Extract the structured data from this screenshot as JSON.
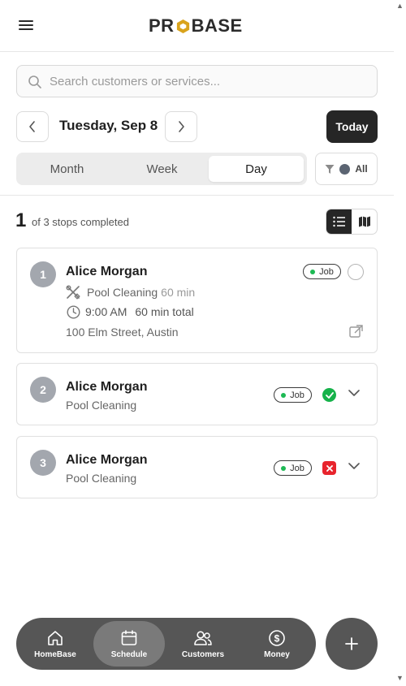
{
  "header": {
    "logo_text_left": "PR",
    "logo_text_right": "BASE"
  },
  "search": {
    "placeholder": "Search customers or services..."
  },
  "date_nav": {
    "title": "Tuesday, Sep 8",
    "today_label": "Today"
  },
  "views": {
    "month": "Month",
    "week": "Week",
    "day": "Day",
    "active": "Day"
  },
  "filter": {
    "label": "All"
  },
  "summary": {
    "completed": "1",
    "label": "of 3 stops completed"
  },
  "stops": [
    {
      "number": "1",
      "customer": "Alice Morgan",
      "service": "Pool Cleaning",
      "duration": "60 min",
      "time": "9:00 AM",
      "total": "60 min total",
      "address": "100 Elm Street, Austin",
      "badge": "Job",
      "status": "pending"
    },
    {
      "number": "2",
      "customer": "Alice Morgan",
      "service": "Pool Cleaning",
      "badge": "Job",
      "status": "completed"
    },
    {
      "number": "3",
      "customer": "Alice Morgan",
      "service": "Pool Cleaning",
      "badge": "Job",
      "status": "cancelled"
    }
  ],
  "bottom_nav": {
    "items": [
      {
        "label": "HomeBase",
        "icon": "home-icon"
      },
      {
        "label": "Schedule",
        "icon": "calendar-icon"
      },
      {
        "label": "Customers",
        "icon": "users-icon"
      },
      {
        "label": "Money",
        "icon": "dollar-icon"
      }
    ],
    "active": "Schedule"
  },
  "colors": {
    "brand_dark": "#262626",
    "accent_gold": "#d9a31c",
    "success": "#16b24a",
    "danger": "#e8242d",
    "job_dot": "#1db954",
    "nav_bg": "#565656"
  }
}
